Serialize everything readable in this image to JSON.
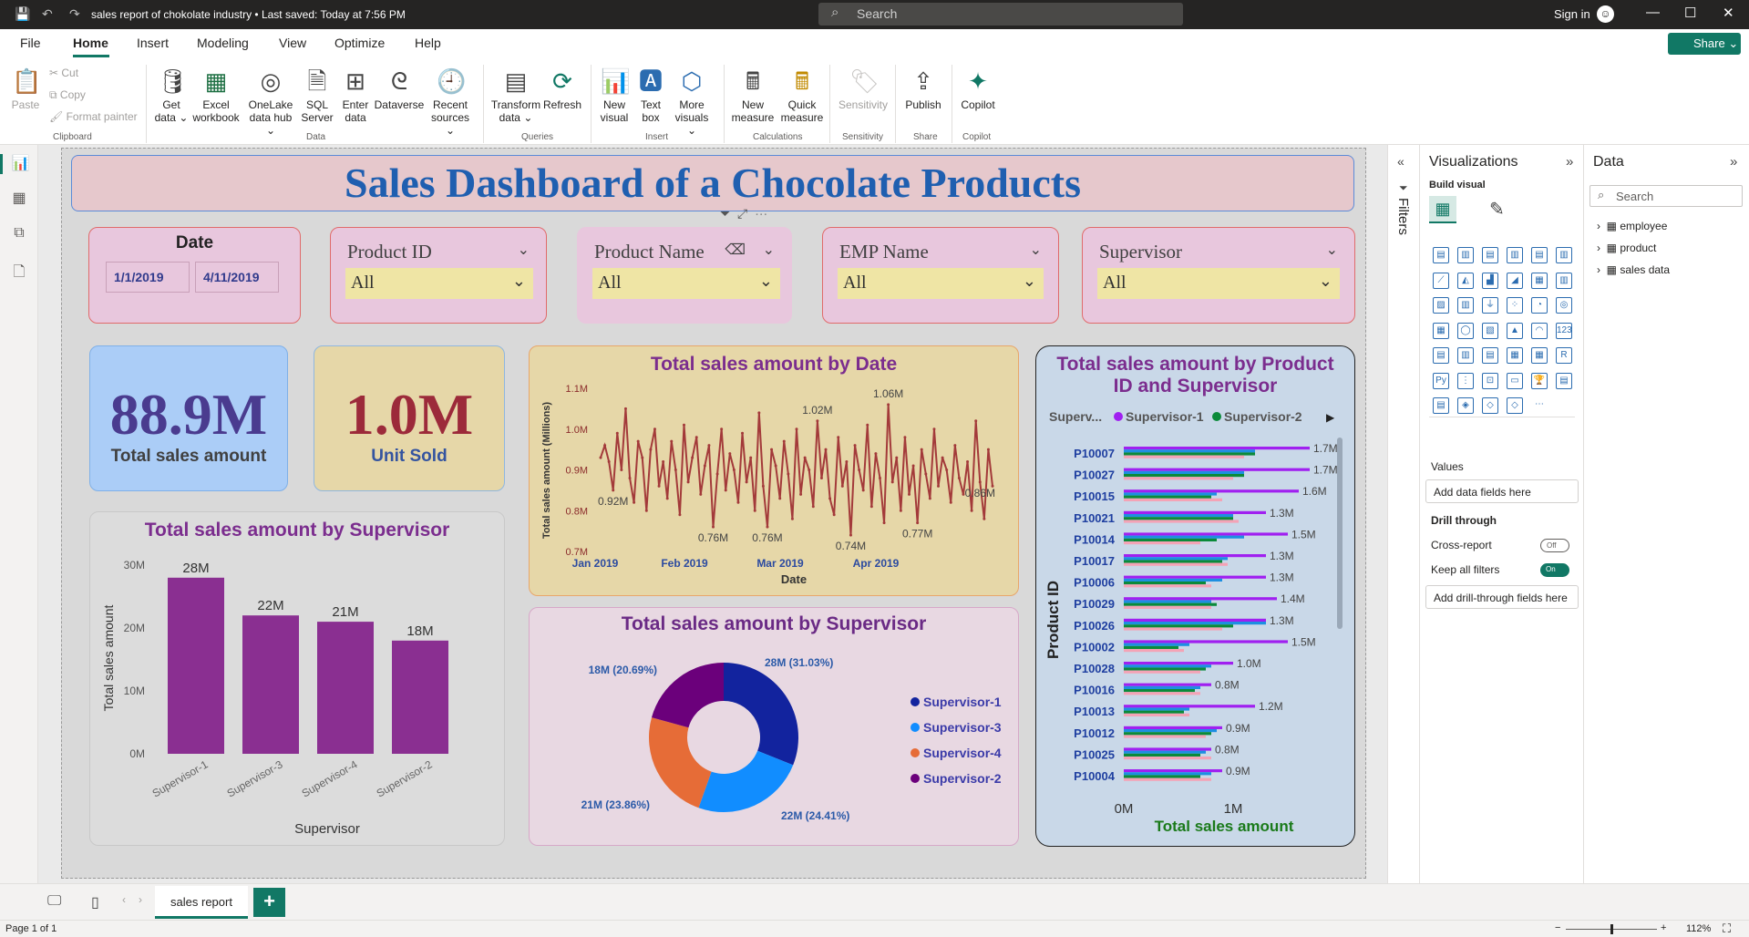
{
  "window": {
    "title": "sales report of chokolate industry  •  Last saved: Today at 7:56 PM",
    "search_placeholder": "Search",
    "signin": "Sign in"
  },
  "menu": {
    "file": "File",
    "home": "Home",
    "insert": "Insert",
    "modeling": "Modeling",
    "view": "View",
    "optimize": "Optimize",
    "help": "Help",
    "share": "Share"
  },
  "ribbon": {
    "paste": "Paste",
    "cut": "Cut",
    "copy": "Copy",
    "format_painter": "Format painter",
    "get_data": "Get data ⌄",
    "excel": "Excel workbook",
    "onelake": "OneLake data hub ⌄",
    "sql": "SQL Server",
    "enter_data": "Enter data",
    "dataverse": "Dataverse",
    "recent": "Recent sources ⌄",
    "transform": "Transform data ⌄",
    "refresh": "Refresh",
    "new_visual": "New visual",
    "text_box": "Text box",
    "more_visuals": "More visuals ⌄",
    "new_measure": "New measure",
    "quick_measure": "Quick measure",
    "sensitivity": "Sensitivity",
    "publish": "Publish",
    "copilot": "Copilot",
    "groups": {
      "clipboard": "Clipboard",
      "data": "Data",
      "queries": "Queries",
      "insert": "Insert",
      "calculations": "Calculations",
      "sensitivity": "Sensitivity",
      "share": "Share",
      "copilot": "Copilot"
    }
  },
  "dashboard": {
    "title": "Sales Dashboard of a Chocolate Products",
    "slicers": {
      "date": {
        "label": "Date",
        "from": "1/1/2019",
        "to": "4/11/2019"
      },
      "product_id": {
        "label": "Product ID",
        "value": "All"
      },
      "product_name": {
        "label": "Product Name",
        "value": "All"
      },
      "emp_name": {
        "label": "EMP Name",
        "value": "All"
      },
      "supervisor": {
        "label": "Supervisor",
        "value": "All"
      }
    },
    "kpis": {
      "sales": {
        "value": "88.9M",
        "label": "Total sales amount"
      },
      "units": {
        "value": "1.0M",
        "label": "Unit Sold"
      }
    }
  },
  "chart_data": [
    {
      "type": "line",
      "title": "Total sales amount by Date",
      "xlabel": "Date",
      "ylabel": "Total sales amount (Millions)",
      "y_ticks": [
        "0.7M",
        "0.8M",
        "0.9M",
        "1.0M",
        "1.1M"
      ],
      "x_ticks": [
        "Jan 2019",
        "Feb 2019",
        "Mar 2019",
        "Apr 2019"
      ],
      "ylim": [
        0.7,
        1.1
      ],
      "values": [
        0.93,
        0.96,
        0.92,
        0.85,
        0.99,
        0.9,
        1.05,
        0.88,
        0.82,
        0.97,
        0.93,
        0.8,
        0.95,
        1.0,
        0.86,
        0.92,
        0.83,
        0.97,
        0.9,
        0.79,
        1.01,
        0.87,
        0.93,
        0.98,
        0.84,
        0.91,
        0.96,
        0.76,
        0.89,
        1.0,
        0.85,
        0.94,
        0.9,
        0.82,
        0.99,
        0.87,
        0.93,
        0.8,
        1.04,
        0.86,
        0.76,
        0.95,
        0.91,
        0.83,
        0.97,
        0.89,
        0.78,
        1.0,
        0.84,
        0.93,
        0.9,
        0.81,
        1.02,
        0.88,
        0.95,
        0.83,
        0.79,
        0.98,
        0.86,
        0.92,
        0.74,
        0.96,
        0.9,
        0.85,
        1.01,
        0.81,
        0.94,
        0.88,
        0.77,
        1.06,
        0.87,
        0.93,
        0.8,
        0.98,
        0.84,
        0.91,
        0.77,
        0.95,
        0.89,
        0.83,
        1.0,
        0.86,
        0.93,
        0.9,
        0.82,
        0.96,
        0.88,
        0.84,
        0.92,
        0.8,
        1.02,
        0.87,
        0.78,
        0.95,
        0.86
      ],
      "annotations": [
        {
          "i": 3,
          "label": "0.92M"
        },
        {
          "i": 27,
          "label": "0.76M"
        },
        {
          "i": 40,
          "label": "0.76M"
        },
        {
          "i": 52,
          "label": "1.02M"
        },
        {
          "i": 60,
          "label": "0.74M"
        },
        {
          "i": 69,
          "label": "1.06M"
        },
        {
          "i": 76,
          "label": "0.77M"
        },
        {
          "i": 91,
          "label": "0.86M"
        }
      ]
    },
    {
      "type": "bar",
      "title": "Total sales amount by Supervisor",
      "xlabel": "Supervisor",
      "ylabel": "Total sales amount",
      "categories": [
        "Supervisor-1",
        "Supervisor-3",
        "Supervisor-4",
        "Supervisor-2"
      ],
      "values": [
        28,
        22,
        21,
        18
      ],
      "labels": [
        "28M",
        "22M",
        "21M",
        "18M"
      ],
      "y_ticks": [
        "0M",
        "10M",
        "20M",
        "30M"
      ],
      "ylim": [
        0,
        30
      ],
      "color": "#8a2f91"
    },
    {
      "type": "pie",
      "title": "Total sales amount by Supervisor",
      "categories": [
        "Supervisor-1",
        "Supervisor-3",
        "Supervisor-4",
        "Supervisor-2"
      ],
      "values": [
        31.03,
        24.41,
        23.86,
        20.69
      ],
      "labels": [
        "28M (31.03%)",
        "22M (24.41%)",
        "21M (23.86%)",
        "18M (20.69%)"
      ],
      "colors": [
        "#12239e",
        "#118dff",
        "#e66c37",
        "#6b007b"
      ]
    },
    {
      "type": "bar",
      "orientation": "horizontal",
      "title": "Total sales amount by Product ID and Supervisor",
      "xlabel": "Total sales amount",
      "ylabel": "Product ID",
      "x_ticks": [
        "0M",
        "1M"
      ],
      "legend_title": "Superv...",
      "legend": [
        "Supervisor-1",
        "Supervisor-2"
      ],
      "categories": [
        "P10007",
        "P10027",
        "P10015",
        "P10021",
        "P10014",
        "P10017",
        "P10006",
        "P10029",
        "P10026",
        "P10002",
        "P10028",
        "P10016",
        "P10013",
        "P10012",
        "P10025",
        "P10004"
      ],
      "series": [
        {
          "name": "Supervisor-1",
          "color": "#a020f0",
          "values": [
            1.7,
            1.7,
            1.6,
            1.3,
            1.5,
            1.3,
            1.3,
            1.4,
            1.3,
            1.5,
            1.0,
            0.8,
            1.2,
            0.9,
            0.8,
            0.9
          ]
        },
        {
          "color": "#1d8fe1",
          "values": [
            1.2,
            1.1,
            0.85,
            1.0,
            1.1,
            0.95,
            0.9,
            0.8,
            1.3,
            0.6,
            0.8,
            0.7,
            0.6,
            0.85,
            0.75,
            0.8
          ]
        },
        {
          "name": "Supervisor-2",
          "color": "#0b8a3a",
          "values": [
            1.2,
            1.1,
            0.8,
            1.0,
            0.85,
            0.9,
            0.75,
            0.85,
            1.0,
            0.5,
            0.75,
            0.65,
            0.55,
            0.8,
            0.7,
            0.7
          ]
        },
        {
          "color": "#f4a3b6",
          "values": [
            1.1,
            1.0,
            0.9,
            1.05,
            0.7,
            0.95,
            0.8,
            0.8,
            0.9,
            0.55,
            0.7,
            0.7,
            0.6,
            0.75,
            0.8,
            0.8
          ]
        }
      ],
      "value_labels": [
        "1.7M",
        "1.7M",
        "1.6M",
        "1.3M",
        "1.5M",
        "1.3M",
        "1.3M",
        "1.4M",
        "1.3M",
        "1.5M",
        "1.0M",
        "0.8M",
        "1.2M",
        "0.9M",
        "0.8M",
        "0.9M"
      ]
    }
  ],
  "panes": {
    "filters": "Filters",
    "visualizations": "Visualizations",
    "build_visual": "Build visual",
    "values": "Values",
    "add_data_fields": "Add data fields here",
    "drill_through": "Drill through",
    "cross_report": "Cross-report",
    "cross_report_state": "Off",
    "keep_filters": "Keep all filters",
    "keep_filters_state": "On",
    "add_drill": "Add drill-through fields here",
    "data": "Data",
    "data_search": "Search",
    "tables": [
      "employee",
      "product",
      "sales data"
    ]
  },
  "bottom": {
    "tab": "sales report",
    "status": "Page 1 of 1",
    "zoom": "112%"
  }
}
